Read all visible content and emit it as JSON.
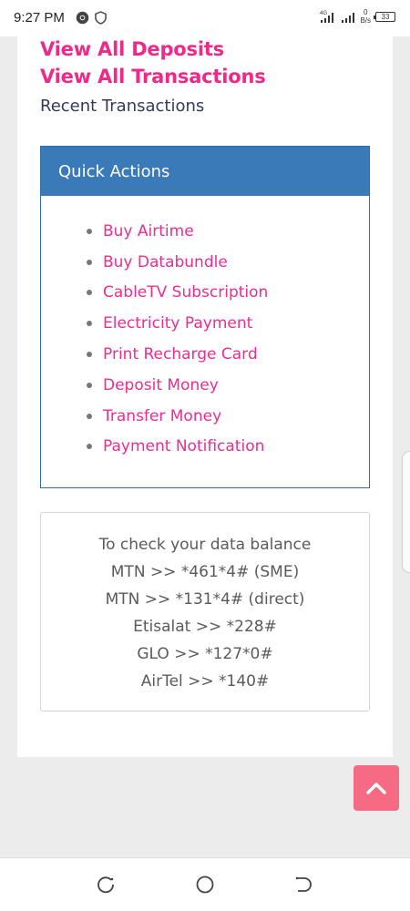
{
  "status_bar": {
    "time": "9:27 PM",
    "network": "4G",
    "data_rate_value": "0",
    "data_rate_unit": "B/s",
    "battery": "33"
  },
  "links": {
    "view_all_deposits": "View All Deposits",
    "view_all_transactions": "View All Transactions"
  },
  "recent_label": "Recent Transactions",
  "quick_actions": {
    "title": "Quick Actions",
    "items": [
      "Buy Airtime",
      "Buy Databundle",
      "CableTV Subscription",
      "Electricity Payment",
      "Print Recharge Card",
      "Deposit Money",
      "Transfer Money",
      "Payment Notification"
    ]
  },
  "data_balance": {
    "lines": [
      "To check your data balance",
      "MTN >> *461*4# (SME)",
      "MTN >> *131*4# (direct)",
      "Etisalat >> *228#",
      "GLO >> *127*0#",
      "AirTel >> *140#"
    ]
  },
  "colors": {
    "accent_pink": "#f0288a",
    "header_blue": "#3a7ab8",
    "scroll_button": "#f56b84"
  },
  "icons": {
    "scroll_top": "chevron-up-icon",
    "nav_recent": "recent-apps-icon",
    "nav_home": "home-icon",
    "nav_back": "back-icon"
  }
}
